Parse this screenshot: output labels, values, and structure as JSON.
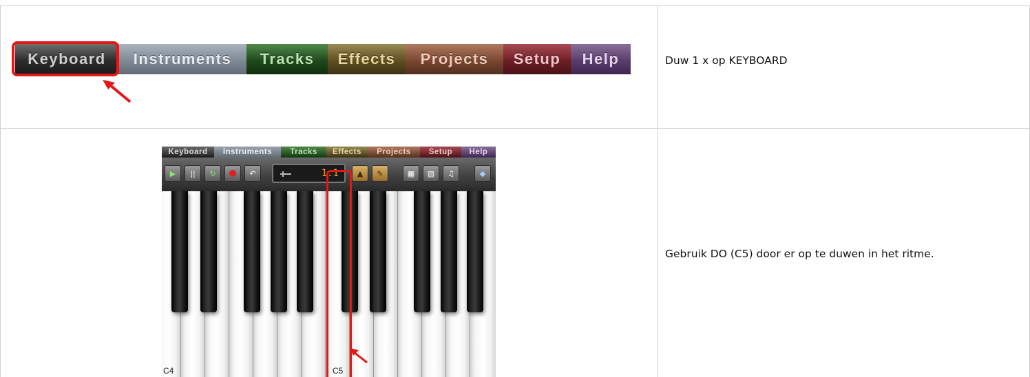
{
  "rows": [
    {
      "instruction": "Duw 1 x op KEYBOARD"
    },
    {
      "instruction": "Gebruik DO (C5) door er op te duwen in het ritme."
    }
  ],
  "tabs": [
    {
      "label": "Keyboard"
    },
    {
      "label": "Instruments"
    },
    {
      "label": "Tracks"
    },
    {
      "label": "Effects"
    },
    {
      "label": "Projects"
    },
    {
      "label": "Setup"
    },
    {
      "label": "Help"
    }
  ],
  "app": {
    "counter": "1.1",
    "key_labels": {
      "c4": "C4",
      "c5": "C5"
    }
  },
  "colors": {
    "highlight": "#e01818",
    "border": "#cfcfcf"
  }
}
